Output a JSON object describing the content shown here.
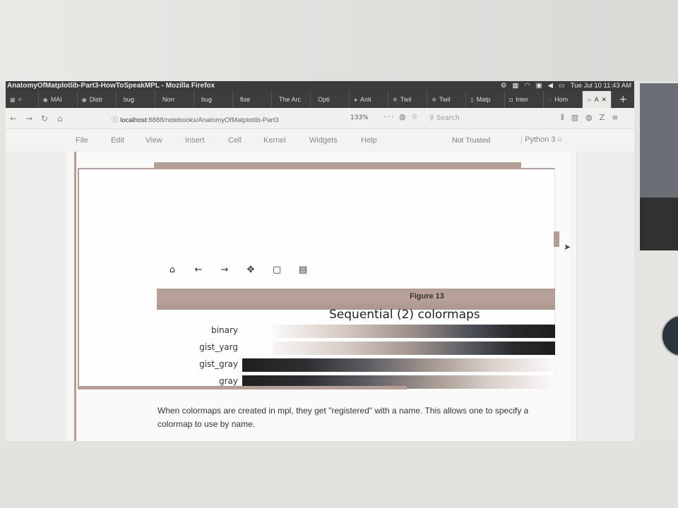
{
  "window": {
    "title": "AnatomyOfMatplotlib-Part3-HowToSpeakMPL - Mozilla Firefox",
    "clock": "Tue Jul 10 11:43 AM"
  },
  "tabs": [
    "MAI",
    "Distr",
    "bug",
    "Norr",
    "bug",
    "fixe",
    "The Arc",
    "Opti",
    "Anti",
    "Twil",
    "Twil",
    "Matp",
    "Inter",
    "Hom",
    "A"
  ],
  "nav": {
    "url_host": "localhost",
    "url_rest": ":8888/notebooks/AnatomyOfMatplotlib-Part3",
    "zoom": "133%",
    "search_placeholder": "Search"
  },
  "menu": {
    "items": [
      "File",
      "Edit",
      "View",
      "Insert",
      "Cell",
      "Kernel",
      "Widgets",
      "Help"
    ],
    "trust_status": "Not Trusted",
    "kernel_name": "Python 3"
  },
  "figure": {
    "label": "Figure 13",
    "toolbar_icons": [
      "home-icon",
      "back-arrow-icon",
      "forward-arrow-icon",
      "pan-icon",
      "zoom-rect-icon",
      "save-icon"
    ]
  },
  "chart_data": {
    "type": "heatmap",
    "title": "Sequential (2) colormaps",
    "colormaps": [
      "binary",
      "gist_yarg",
      "gist_gray",
      "gray"
    ]
  },
  "markdown": {
    "text": "When colormaps are created in mpl, they get \"registered\" with a name. This allows one to specify a colormap to use by name."
  },
  "colors": {
    "accent": "#b59e95",
    "titlebar": "#3a3b3a"
  }
}
